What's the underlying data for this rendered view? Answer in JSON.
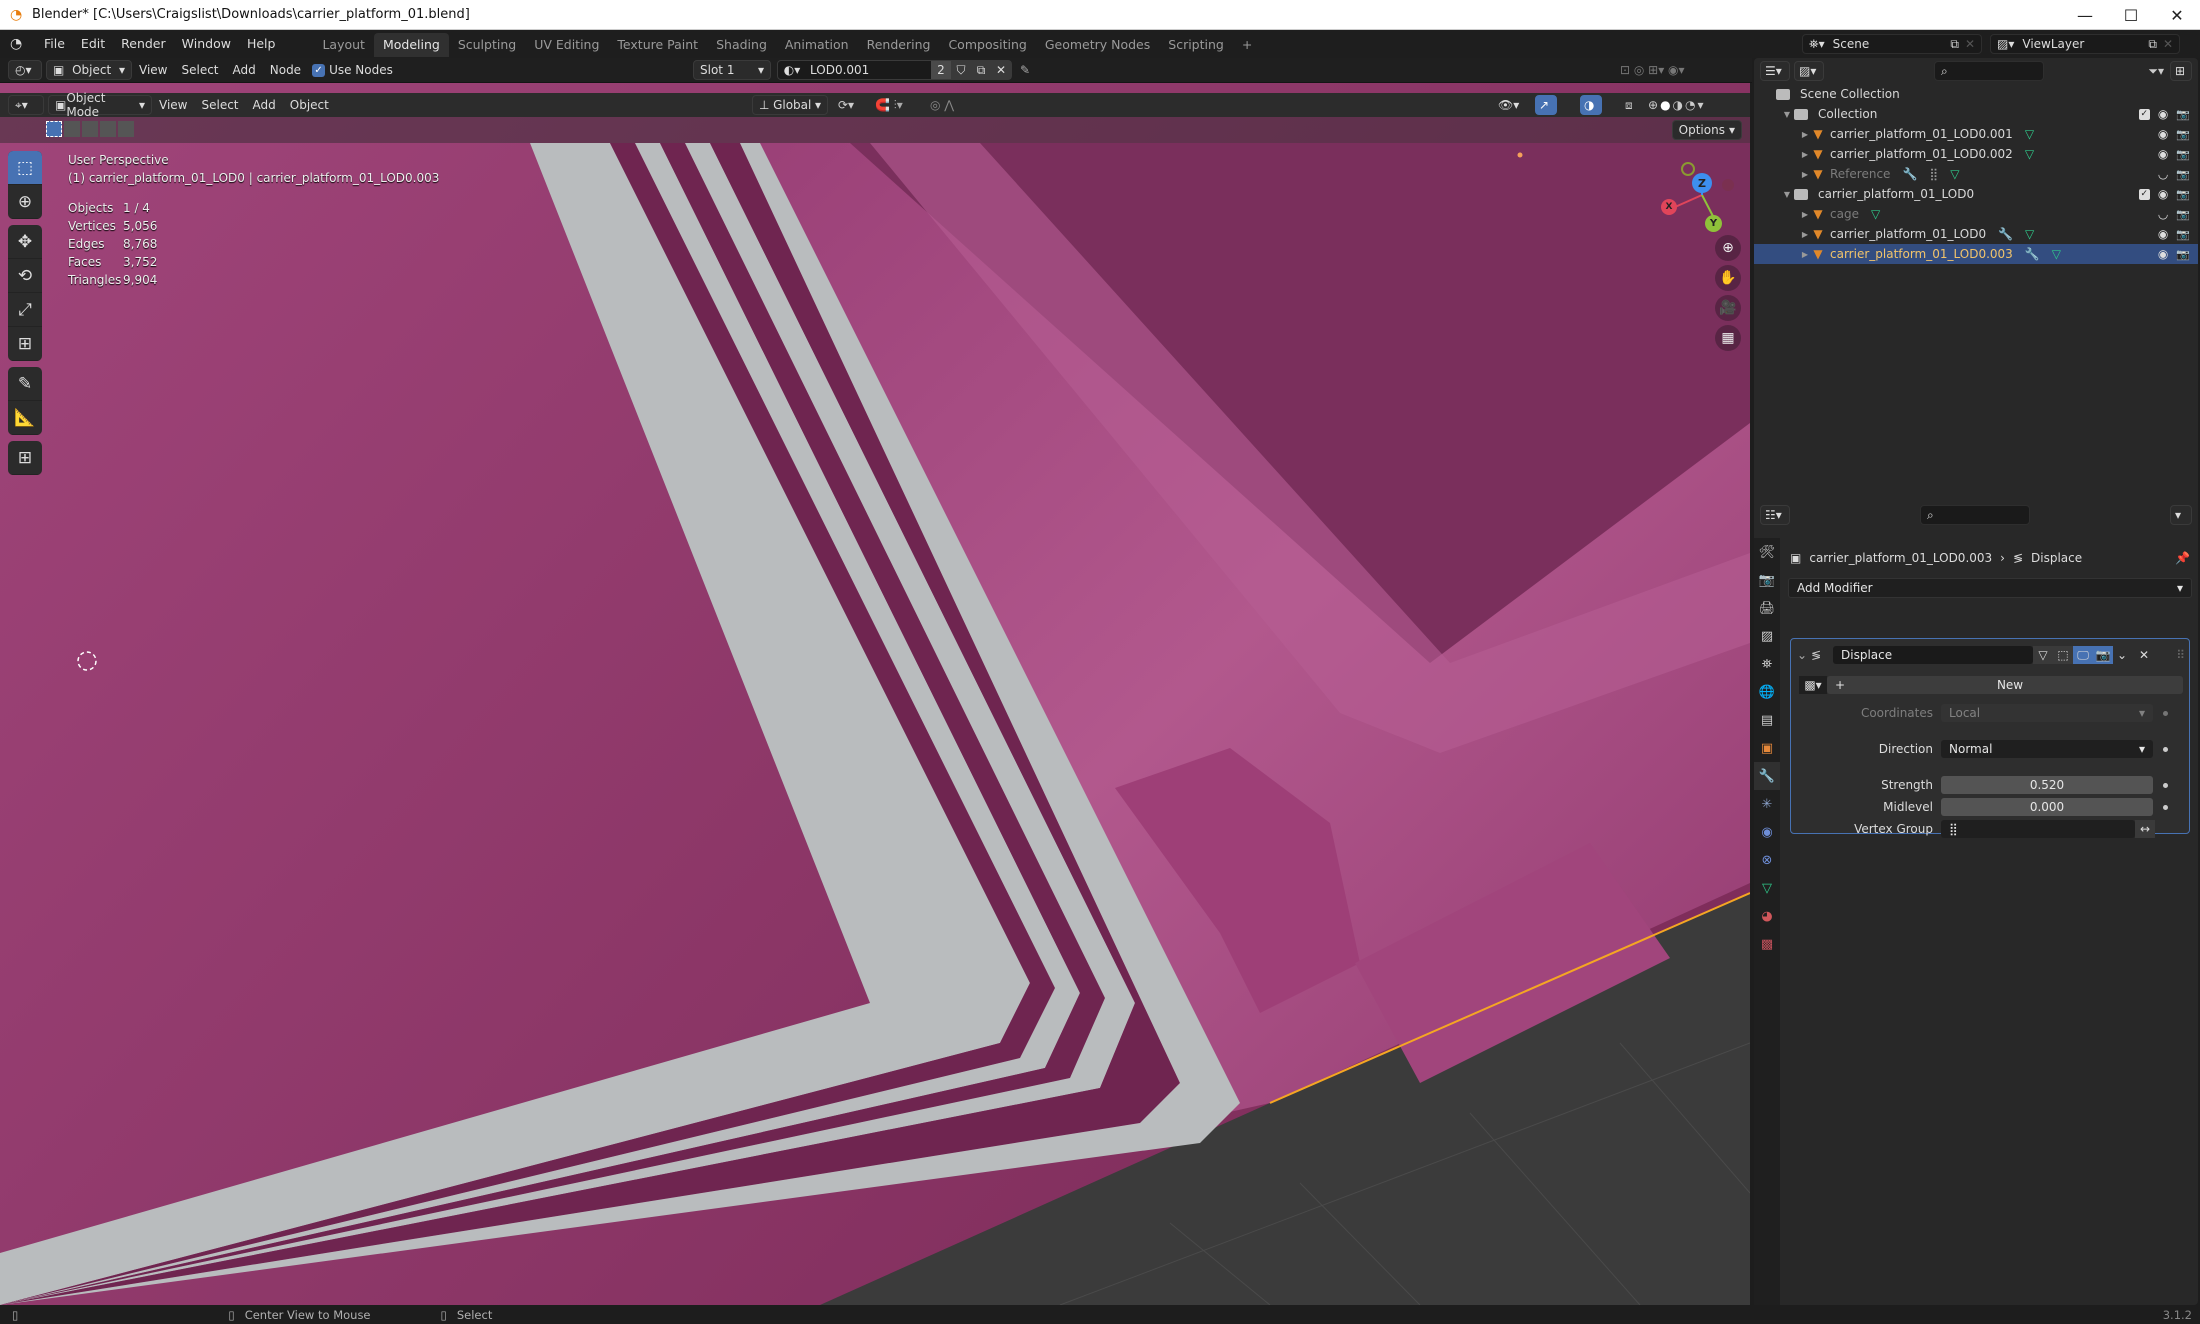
{
  "window": {
    "title": "Blender* [C:\\Users\\Craigslist\\Downloads\\carrier_platform_01.blend]",
    "controls": {
      "minimize": "—",
      "maximize": "☐",
      "close": "✕"
    }
  },
  "menubar": {
    "menus": [
      "File",
      "Edit",
      "Render",
      "Window",
      "Help"
    ],
    "workspaces": [
      "Layout",
      "Modeling",
      "Sculpting",
      "UV Editing",
      "Texture Paint",
      "Shading",
      "Animation",
      "Rendering",
      "Compositing",
      "Geometry Nodes",
      "Scripting"
    ],
    "active_workspace": "Modeling",
    "add_workspace": "+"
  },
  "editor_header": {
    "mode": "Object",
    "menus": [
      "View",
      "Select",
      "Add",
      "Node"
    ],
    "use_nodes_label": "Use Nodes",
    "use_nodes_checked": true,
    "slot": "Slot 1",
    "material": "LOD0.001",
    "material_users": "2"
  },
  "viewport": {
    "header": {
      "mode": "Object Mode",
      "menus": [
        "View",
        "Select",
        "Add",
        "Object"
      ],
      "orientation": "Global",
      "options_label": "Options"
    },
    "overlay": {
      "view_name": "User Perspective",
      "object_path": "(1) carrier_platform_01_LOD0 | carrier_platform_01_LOD0.003",
      "stats": [
        {
          "label": "Objects",
          "value": "1 / 4"
        },
        {
          "label": "Vertices",
          "value": "5,056"
        },
        {
          "label": "Edges",
          "value": "8,768"
        },
        {
          "label": "Faces",
          "value": "3,752"
        },
        {
          "label": "Triangles",
          "value": "9,904"
        }
      ]
    },
    "gizmo": {
      "x": "X",
      "y": "Y",
      "z": "Z"
    },
    "colors": {
      "mesh": "#8c3465",
      "mesh_light": "#a84a82",
      "stripe": "#b9bcbe",
      "stripe_dark": "#6f2550",
      "grid": "#3a3a3a",
      "selection": "#f5a623"
    }
  },
  "outliner": {
    "scene": "Scene",
    "view_layer": "ViewLayer",
    "items": [
      {
        "label": "Scene Collection",
        "type": "scene-collection",
        "depth": 0
      },
      {
        "label": "Collection",
        "type": "collection",
        "depth": 1,
        "expanded": true,
        "checked": true
      },
      {
        "label": "carrier_platform_01_LOD0.001",
        "type": "object",
        "depth": 2,
        "mods": [
          "mesh"
        ]
      },
      {
        "label": "carrier_platform_01_LOD0.002",
        "type": "object",
        "depth": 2,
        "mods": [
          "mesh"
        ]
      },
      {
        "label": "Reference",
        "type": "object",
        "depth": 2,
        "mods": [
          "wrench",
          "vgroup",
          "mesh"
        ],
        "hidden": true
      },
      {
        "label": "carrier_platform_01_LOD0",
        "type": "collection",
        "depth": 1,
        "expanded": true,
        "checked": true
      },
      {
        "label": "cage",
        "type": "object",
        "depth": 2,
        "mods": [
          "mesh"
        ],
        "hidden": true
      },
      {
        "label": "carrier_platform_01_LOD0",
        "type": "object",
        "depth": 2,
        "mods": [
          "wrench",
          "mesh"
        ]
      },
      {
        "label": "carrier_platform_01_LOD0.003",
        "type": "object",
        "depth": 2,
        "mods": [
          "wrench",
          "mesh"
        ],
        "selected": true
      }
    ]
  },
  "properties": {
    "breadcrumb_object": "carrier_platform_01_LOD0.003",
    "breadcrumb_modifier": "Displace",
    "add_modifier_label": "Add Modifier",
    "modifier": {
      "name": "Displace",
      "texture_new_label": "New",
      "coordinates_label": "Coordinates",
      "coordinates_value": "Local",
      "direction_label": "Direction",
      "direction_value": "Normal",
      "strength_label": "Strength",
      "strength_value": "0.520",
      "midlevel_label": "Midlevel",
      "midlevel_value": "0.000",
      "vertex_group_label": "Vertex Group",
      "vertex_group_value": ""
    },
    "tabs": [
      "tool",
      "render",
      "output",
      "view-layer",
      "scene",
      "world",
      "collection",
      "object",
      "modifiers",
      "particles",
      "physics",
      "constraints",
      "data",
      "material",
      "texture"
    ],
    "active_tab": "modifiers"
  },
  "statusbar": {
    "left_hint": "",
    "middle_hint": "Center View to Mouse",
    "right_hint": "Select",
    "version": "3.1.2"
  }
}
